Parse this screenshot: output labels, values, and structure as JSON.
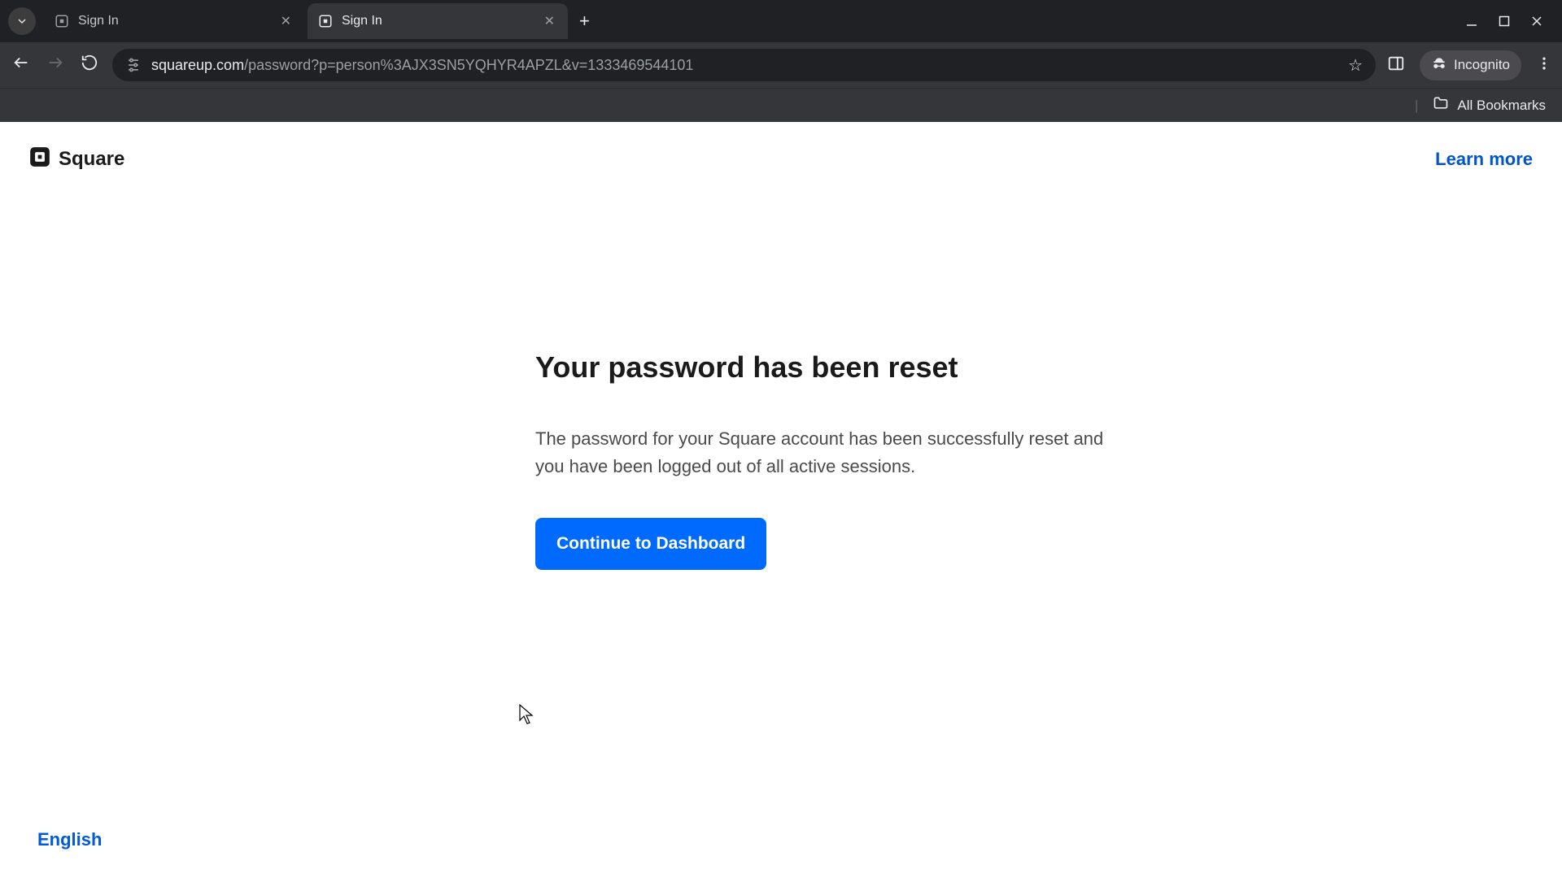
{
  "browser": {
    "tabs": [
      {
        "title": "Sign In",
        "active": false
      },
      {
        "title": "Sign In",
        "active": true
      }
    ],
    "url_host": "squareup.com",
    "url_path": "/password?p=person%3AJX3SN5YQHYR4APZL&v=1333469544101",
    "incognito_label": "Incognito",
    "all_bookmarks_label": "All Bookmarks"
  },
  "header": {
    "brand": "Square",
    "learn_more": "Learn more"
  },
  "main": {
    "heading": "Your password has been reset",
    "body": "The password for your Square account has been successfully reset and you have been logged out of all active sessions.",
    "cta": "Continue to Dashboard"
  },
  "footer": {
    "language": "English"
  }
}
